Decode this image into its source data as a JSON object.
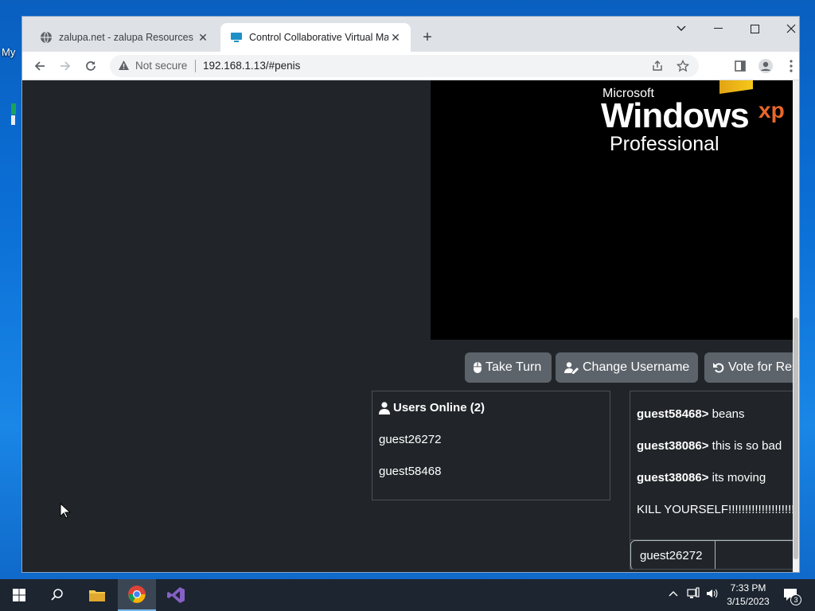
{
  "desktop": {
    "icon_label_fragment": "My"
  },
  "browser": {
    "tabs": [
      {
        "title": "zalupa.net - zalupa Resources ar",
        "active": false
      },
      {
        "title": "Control Collaborative Virtual Ma",
        "active": true
      }
    ],
    "address_bar": {
      "security_label": "Not secure",
      "url": "192.168.1.13/#penis"
    }
  },
  "vm_screen": {
    "brand_small": "Microsoft",
    "brand_big": "Windows",
    "brand_suffix": "xp",
    "edition": "Professional"
  },
  "actions": {
    "take_turn": "Take Turn",
    "change_username": "Change Username",
    "vote_reset": "Vote for Res"
  },
  "users_online": {
    "heading": "Users Online (2)",
    "users": [
      "guest26272",
      "guest58468"
    ]
  },
  "chat": {
    "messages": [
      {
        "user": "guest58468>",
        "text": " beans"
      },
      {
        "user": "guest38086>",
        "text": " this is so bad"
      },
      {
        "user": "guest38086>",
        "text": " its moving"
      },
      {
        "user": "",
        "text": "KILL YOURSELF!!!!!!!!!!!!!!!!!!!!!!"
      }
    ],
    "username_display": "guest26272"
  },
  "taskbar": {
    "time": "7:33 PM",
    "date": "3/15/2023",
    "notification_count": "3"
  },
  "colors": {
    "page_bg": "#212529",
    "button_bg": "#5c636a",
    "panel_border": "#495057",
    "taskbar_bg": "#1c2530"
  }
}
